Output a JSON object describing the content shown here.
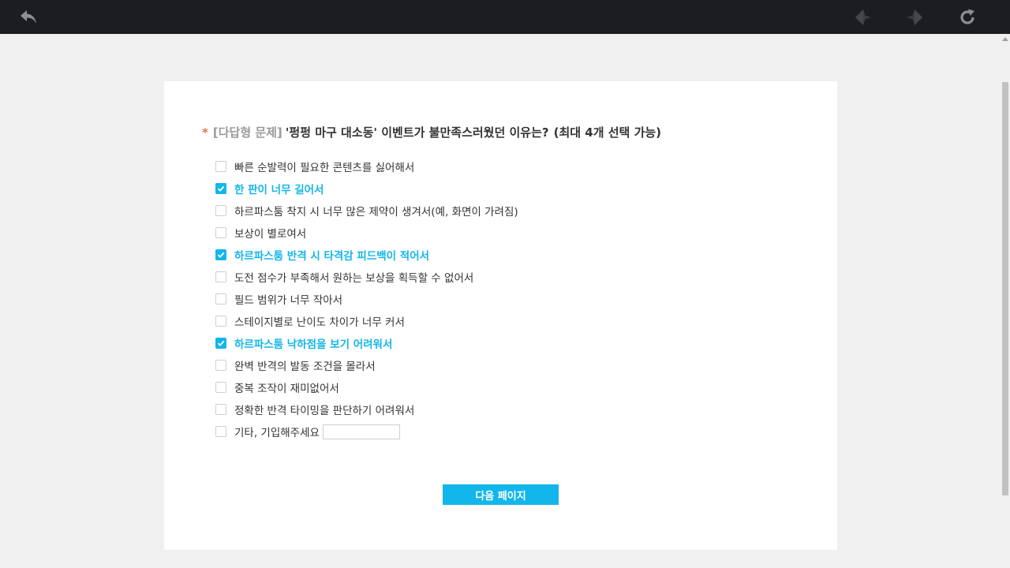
{
  "colors": {
    "accent": "#13b6ea",
    "star": "#e8735a",
    "topbar": "#1c1d20"
  },
  "toolbar": {
    "back_icon": "undo-arrow-icon",
    "prev_icon": "sparkle-left-icon",
    "next_icon": "sparkle-right-icon",
    "refresh_icon": "refresh-icon"
  },
  "question": {
    "required_mark": "*",
    "type_tag": "[다답형 문제]",
    "text": "'펑펑 마구 대소동' 이벤트가 불만족스러웠던 이유는?",
    "hint": "(최대 4개 선택 가능)"
  },
  "options": [
    {
      "label": "빠른 순발력이 필요한 콘텐츠를 싫어해서",
      "checked": false
    },
    {
      "label": "한 판이 너무 길어서",
      "checked": true
    },
    {
      "label": "하르파스툼 착지 시 너무 많은 제약이 생겨서(예, 화면이 가려짐)",
      "checked": false
    },
    {
      "label": "보상이 별로여서",
      "checked": false
    },
    {
      "label": "하르파스툼 반격 시 타격감 피드백이 적어서",
      "checked": true
    },
    {
      "label": "도전 점수가 부족해서 원하는 보상을 획득할 수 없어서",
      "checked": false
    },
    {
      "label": "필드 범위가 너무 작아서",
      "checked": false
    },
    {
      "label": "스테이지별로 난이도 차이가 너무 커서",
      "checked": false
    },
    {
      "label": "하르파스툼 낙하점을 보기 어려워서",
      "checked": true
    },
    {
      "label": "완벽 반격의 발동 조건을 몰라서",
      "checked": false
    },
    {
      "label": "중복 조작이 재미없어서",
      "checked": false
    },
    {
      "label": "정확한 반격 타이밍을 판단하기 어려워서",
      "checked": false
    },
    {
      "label": "기타, 기입해주세요",
      "checked": false,
      "other_value": ""
    }
  ],
  "next_button": {
    "label": "다음 페이지"
  }
}
